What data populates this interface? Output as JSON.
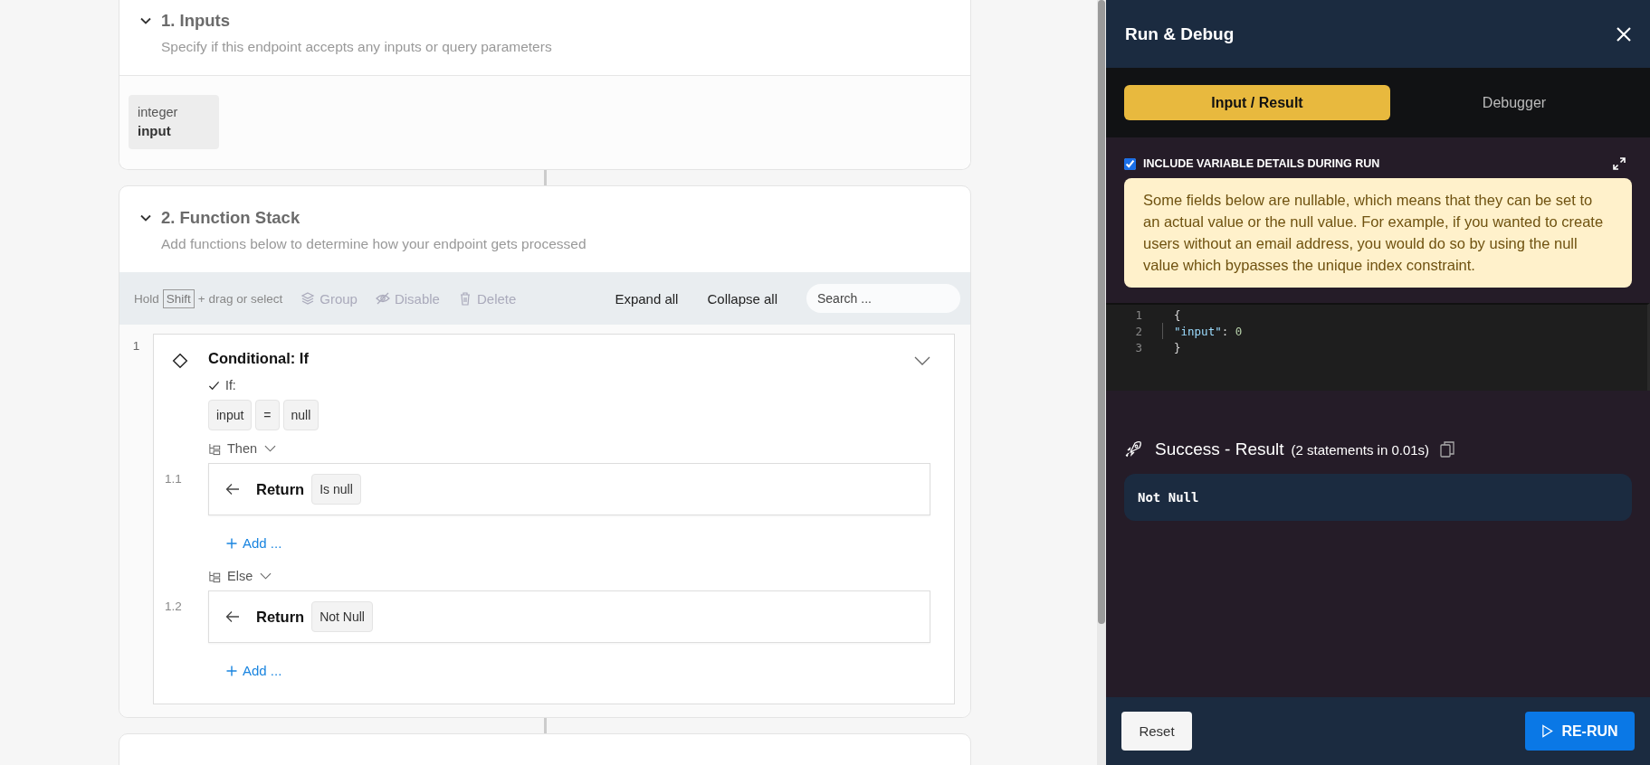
{
  "inputs_section": {
    "title": "1. Inputs",
    "subtitle": "Specify if this endpoint accepts any inputs or query parameters",
    "expanded": true,
    "params": [
      {
        "type": "integer",
        "name": "input"
      }
    ]
  },
  "function_stack": {
    "title": "2. Function Stack",
    "subtitle": "Add functions below to determine how your endpoint gets processed",
    "expanded": true,
    "toolbar": {
      "hint_prefix": "Hold",
      "hint_key": "Shift",
      "hint_suffix": "+ drag or select",
      "actions": [
        {
          "kind": "group",
          "label": "Group",
          "disabled": true
        },
        {
          "kind": "disable",
          "label": "Disable",
          "disabled": true
        },
        {
          "kind": "delete",
          "label": "Delete",
          "disabled": true
        }
      ],
      "expand_all": "Expand all",
      "collapse_all": "Collapse all",
      "search": {
        "placeholder": "Search ..."
      }
    },
    "steps": [
      {
        "number": "1",
        "title": "Conditional: If",
        "expanded": true,
        "condition_label": "If:",
        "condition": [
          "input",
          "=",
          "null"
        ],
        "branches": [
          {
            "label": "Then",
            "expanded": true,
            "steps": [
              {
                "number": "1.1",
                "keyword": "Return",
                "value": "Is null"
              }
            ],
            "add_label": "Add ..."
          },
          {
            "label": "Else",
            "expanded": true,
            "steps": [
              {
                "number": "1.2",
                "keyword": "Return",
                "value": "Not Null"
              }
            ],
            "add_label": "Add ..."
          }
        ]
      }
    ]
  },
  "panel": {
    "title": "Run & Debug",
    "tabs": [
      {
        "label": "Input / Result",
        "selected": true
      },
      {
        "label": "Debugger",
        "selected": false
      }
    ],
    "include_details": {
      "label": "INCLUDE VARIABLE DETAILS DURING RUN",
      "checked": true
    },
    "notice": "Some fields below are nullable, which means that they can be set to an actual value or the null value. For example, if you wanted to create users without an email address, you would do so by using the null value which bypasses the unique index constraint.",
    "editor_lines": [
      {
        "number": "1",
        "indented": false,
        "tokens": [
          {
            "kind": "punct",
            "text": "{"
          }
        ]
      },
      {
        "number": "2",
        "indented": true,
        "tokens": [
          {
            "kind": "key",
            "text": "\"input\""
          },
          {
            "kind": "punct",
            "text": ": "
          },
          {
            "kind": "number",
            "text": "0"
          }
        ]
      },
      {
        "number": "3",
        "indented": false,
        "tokens": [
          {
            "kind": "punct",
            "text": "}"
          }
        ]
      }
    ],
    "result": {
      "title": "Success - Result",
      "detail": "(2 statements in 0.01s)",
      "value": "Not Null"
    },
    "reset_label": "Reset",
    "rerun_label": "RE-RUN"
  }
}
